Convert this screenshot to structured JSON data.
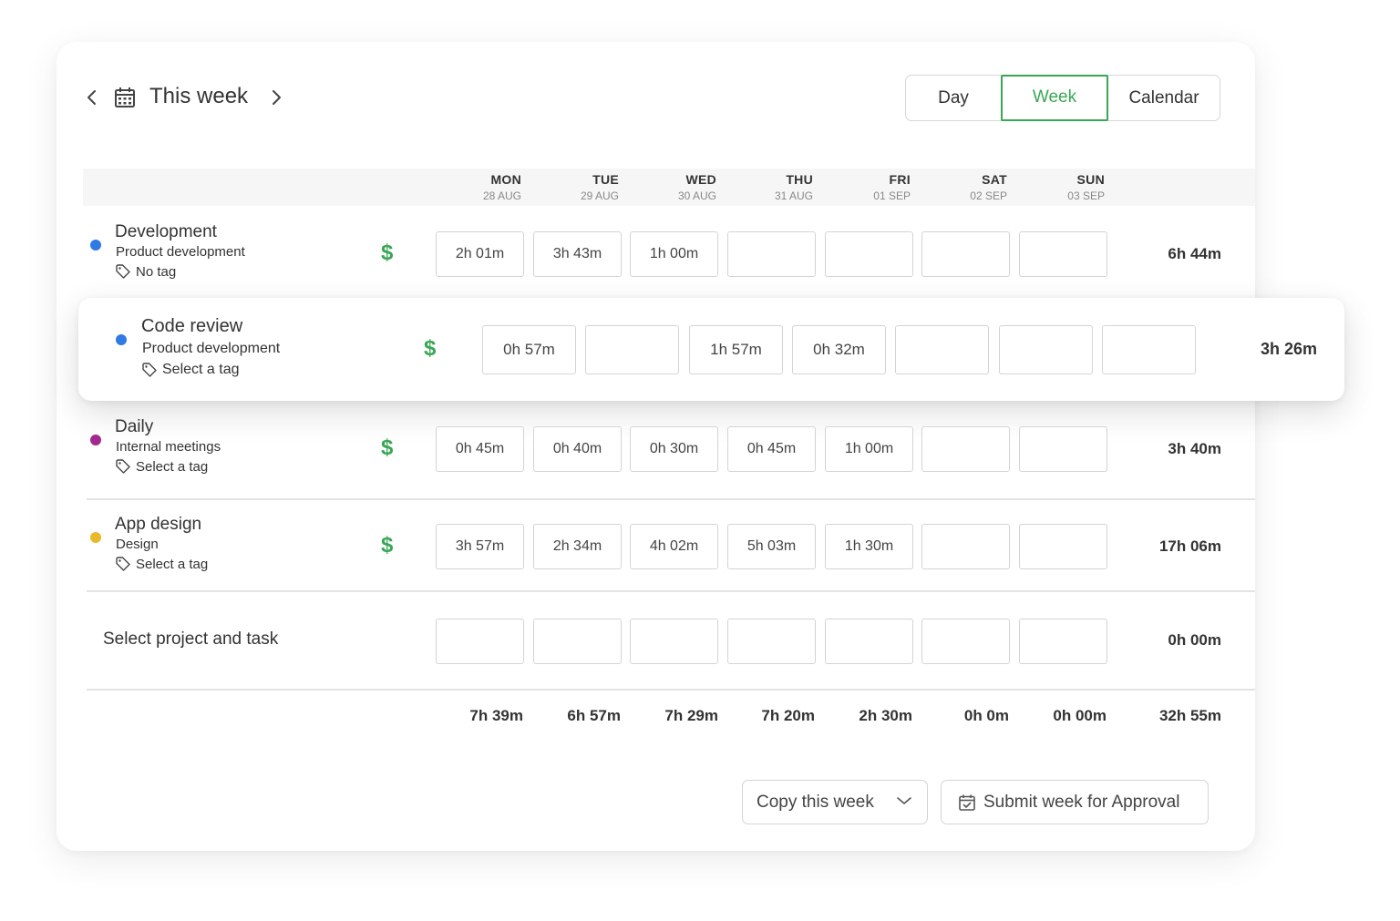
{
  "header": {
    "title": "This week",
    "views": {
      "day": "Day",
      "week": "Week",
      "calendar": "Calendar",
      "active": "week"
    }
  },
  "days": [
    {
      "name": "MON",
      "date": "28 AUG"
    },
    {
      "name": "TUE",
      "date": "29 AUG"
    },
    {
      "name": "WED",
      "date": "30 AUG"
    },
    {
      "name": "THU",
      "date": "31 AUG"
    },
    {
      "name": "FRI",
      "date": "01 SEP"
    },
    {
      "name": "SAT",
      "date": "02 SEP"
    },
    {
      "name": "SUN",
      "date": "03 SEP"
    }
  ],
  "rows": [
    {
      "task": "Development",
      "project": "Product development",
      "tag": "No tag",
      "dot_color": "#2f7ae5",
      "billable": "$",
      "entries": [
        "2h 01m",
        "3h 43m",
        "1h 00m",
        "",
        "",
        "",
        ""
      ],
      "total": "6h 44m"
    },
    {
      "task": "Code review",
      "project": "Product development",
      "tag": "Select a tag",
      "dot_color": "#2f7ae5",
      "billable": "$",
      "entries": [
        "0h 57m",
        "",
        "1h 57m",
        "0h 32m",
        "",
        "",
        ""
      ],
      "total": "3h 26m"
    },
    {
      "task": "Daily",
      "project": "Internal meetings",
      "tag": "Select a tag",
      "dot_color": "#a3288f",
      "billable": "$",
      "entries": [
        "0h 45m",
        "0h 40m",
        "0h 30m",
        "0h 45m",
        "1h 00m",
        "",
        ""
      ],
      "total": "3h 40m"
    },
    {
      "task": "App design",
      "project": "Design",
      "tag": "Select a tag",
      "dot_color": "#e8b92a",
      "billable": "$",
      "entries": [
        "3h 57m",
        "2h 34m",
        "4h 02m",
        "5h 03m",
        "1h 30m",
        "",
        ""
      ],
      "total": "17h 06m"
    }
  ],
  "new_row": {
    "label": "Select project and task",
    "entries": [
      "",
      "",
      "",
      "",
      "",
      "",
      ""
    ],
    "total": "0h 00m"
  },
  "day_totals": [
    "7h 39m",
    "6h 57m",
    "7h 29m",
    "7h 20m",
    "2h 30m",
    "0h 0m",
    "0h 00m"
  ],
  "grand_total": "32h 55m",
  "footer": {
    "copy_label": "Copy this week",
    "submit_label": "Submit week for Approval"
  },
  "colors": {
    "accent": "#3aa655"
  }
}
